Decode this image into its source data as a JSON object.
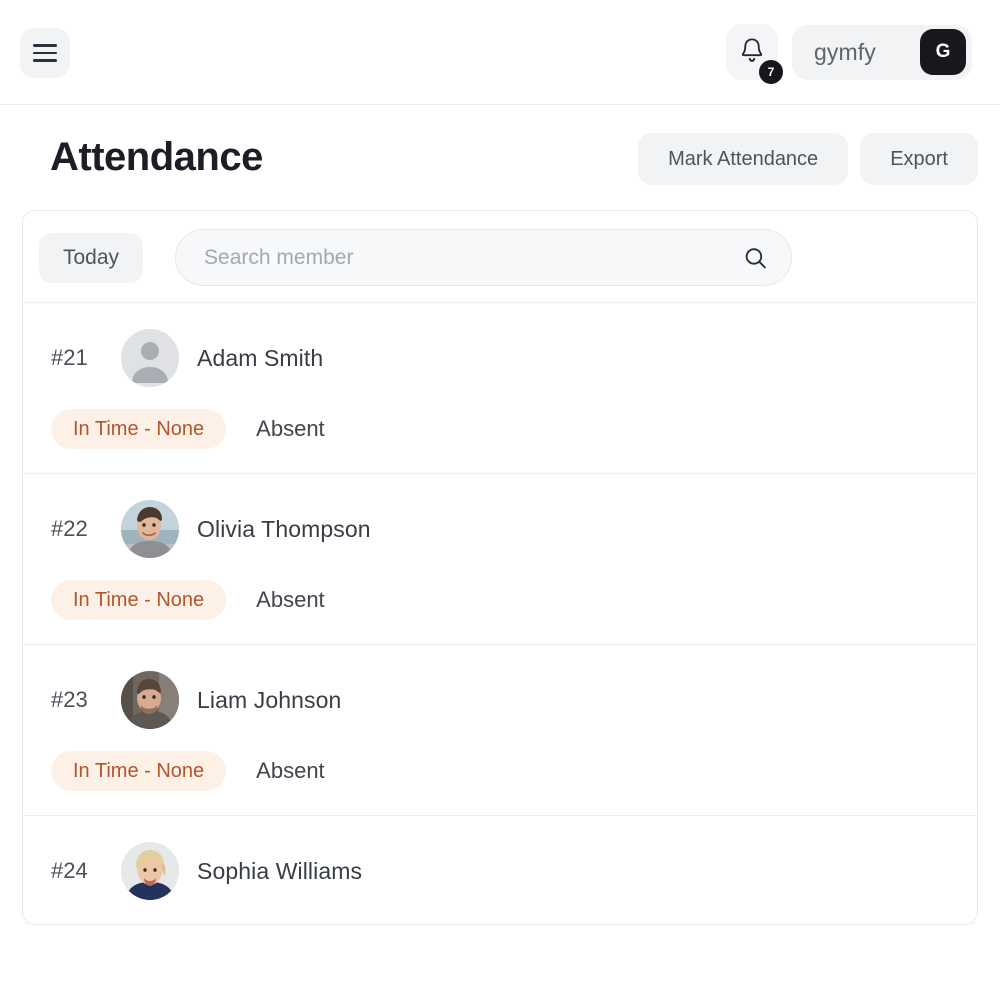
{
  "appbar": {
    "menu_icon": "hamburger-icon",
    "notifications": {
      "icon": "bell-icon",
      "count": "7"
    },
    "brand": {
      "name": "gymfy",
      "avatar_initial": "G"
    }
  },
  "page": {
    "title": "Attendance",
    "actions": [
      {
        "label": "Mark Attendance",
        "name": "mark-attendance-button"
      },
      {
        "label": "Export",
        "name": "export-button"
      }
    ]
  },
  "filters": {
    "date_chip": "Today",
    "search": {
      "value": "",
      "placeholder": "Search member",
      "icon": "search-icon"
    }
  },
  "colors": {
    "badge_bg": "#fdf0e6",
    "badge_text": "#b3562c",
    "accent_dark": "#16181d",
    "surface": "#f2f3f5",
    "border": "#e9eaec"
  },
  "attendance": {
    "rows": [
      {
        "id": "#21",
        "name": "Adam Smith",
        "avatar_type": "placeholder",
        "in_time": "In Time - None",
        "status": "Absent"
      },
      {
        "id": "#22",
        "name": "Olivia Thompson",
        "avatar_type": "photo",
        "in_time": "In Time - None",
        "status": "Absent"
      },
      {
        "id": "#23",
        "name": "Liam Johnson",
        "avatar_type": "photo",
        "in_time": "In Time - None",
        "status": "Absent"
      },
      {
        "id": "#24",
        "name": "Sophia Williams",
        "avatar_type": "photo",
        "in_time": "",
        "status": ""
      }
    ]
  }
}
